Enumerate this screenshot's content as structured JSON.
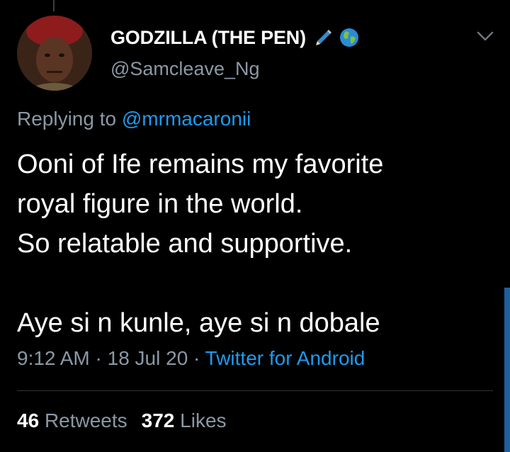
{
  "tweet": {
    "display_name": "GODZILLA (THE PEN)",
    "handle": "@Samcleave_Ng",
    "name_icons": [
      "pen-icon",
      "globe-icon"
    ],
    "replying_prefix": "Replying to",
    "replying_to": "@mrmacaronii",
    "body_lines": [
      "Ooni of Ife remains my favorite",
      "royal figure in the world.",
      "So relatable and supportive.",
      "",
      "Aye si n kunle, aye si n dobale"
    ],
    "time": "9:12 AM",
    "date": "18 Jul 20",
    "source": "Twitter for Android",
    "separator": "·",
    "retweets_count": "46",
    "retweets_label": "Retweets",
    "likes_count": "372",
    "likes_label": "Likes"
  },
  "colors": {
    "background": "#000000",
    "text": "#ffffff",
    "secondary_text": "#8b98a5",
    "accent": "#1d9bf0",
    "divider": "#2f3336"
  }
}
